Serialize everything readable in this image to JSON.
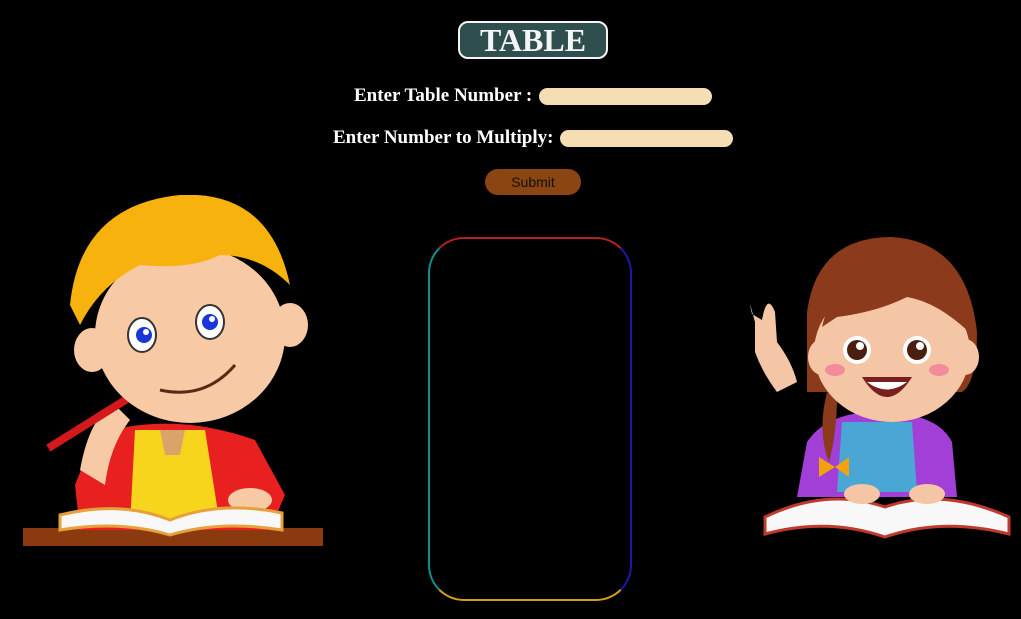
{
  "header": {
    "title": "TABLE"
  },
  "form": {
    "table_label": "Enter Table Number :",
    "table_value": "",
    "multiply_label": "Enter Number to Multiply:",
    "multiply_value": "",
    "submit_label": "Submit"
  },
  "output": {
    "text": ""
  },
  "colors": {
    "background": "#000000",
    "title_bg": "#2f4f4f",
    "input_bg": "#f5deb3",
    "submit_bg": "#8b4513"
  },
  "illustrations": {
    "left": "boy-studying-illustration",
    "right": "girl-reading-illustration"
  }
}
